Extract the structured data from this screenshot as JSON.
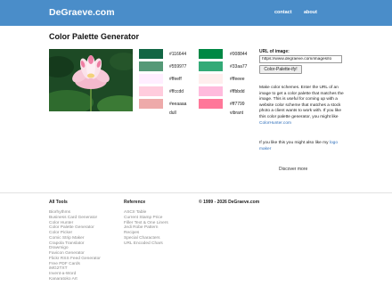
{
  "header": {
    "brand": "DeGraeve.com",
    "nav": [
      "contact",
      "about"
    ]
  },
  "page": {
    "title": "Color Palette Generator",
    "photo_subject": "pink lotus flower"
  },
  "palettes": {
    "dull": {
      "label": "dull",
      "swatches": [
        {
          "hex": "#116644",
          "color": "#116644"
        },
        {
          "hex": "#559977",
          "color": "#559977"
        },
        {
          "hex": "#ffeeff",
          "color": "#ffeeff"
        },
        {
          "hex": "#ffccdd",
          "color": "#ffccdd"
        },
        {
          "hex": "#eeaaaa",
          "color": "#eeaaaa"
        }
      ]
    },
    "vibrant": {
      "label": "vibrant",
      "swatches": [
        {
          "hex": "#008844",
          "color": "#008844"
        },
        {
          "hex": "#33aa77",
          "color": "#33aa77"
        },
        {
          "hex": "#ffeeee",
          "color": "#ffeeee"
        },
        {
          "hex": "#ffbbdd",
          "color": "#ffbbdd"
        },
        {
          "hex": "#ff7799",
          "color": "#ff7799"
        }
      ]
    }
  },
  "form": {
    "url_label": "URL of image:",
    "url_value": "https://www.degraeve.com/images/lo",
    "button_label": "Color-Palette-ify!"
  },
  "description": {
    "text": "Make color schemes. Enter the URL of an image to get a color palette that matches the image. This is useful for coming up with a website color scheme that matches a stock photo a client wants to work with. If you like this color palette generator, you might like ",
    "link": "ColorHunter.com"
  },
  "promo": {
    "text": "If you like this you might also like my ",
    "link": "logo maker"
  },
  "discover": "Discover more",
  "footer": {
    "col1": {
      "title": "All Tools",
      "items": [
        "Biorhythms",
        "Business Card Generator",
        "Color Hunter",
        "Color Palette Generator",
        "Color Picker",
        "Comic Strip Maker",
        "Crapola Translator",
        "Drawmigo",
        "Favicon Generator",
        "Flickr RSS Feed Generator",
        "Free PDF Cards",
        "iMG2TXT",
        "Invent-a-Word",
        "Kanaratoko Art"
      ]
    },
    "col2": {
      "title": "Reference",
      "items": [
        "ASCII Table",
        "Current Stamp Price",
        "Filler Text & One Liners",
        "Jedi Robe Pattern",
        "Recipes",
        "Special Characters",
        "URL Encoded Chars"
      ]
    },
    "copyright": "© 1999 - 2026 DeGraeve.com"
  },
  "colors": {
    "header_bg": "#4a8dc9",
    "link": "#2f6fba",
    "muted": "#8a8a8a"
  }
}
